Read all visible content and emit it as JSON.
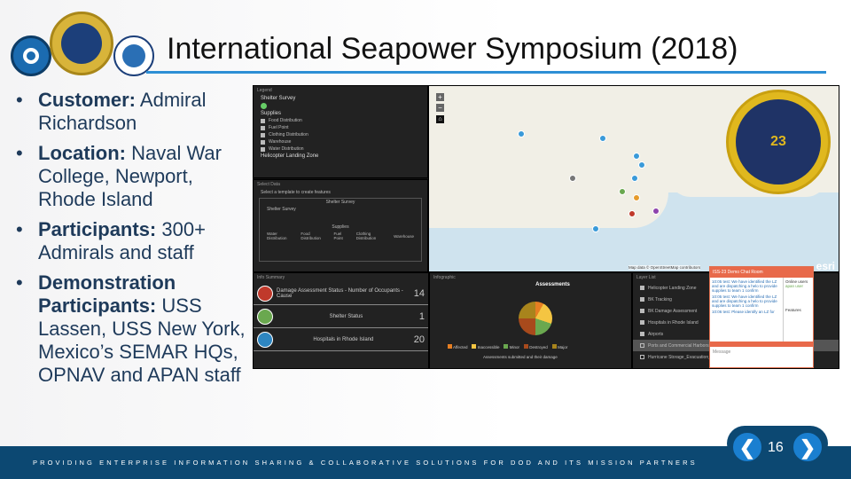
{
  "slide": {
    "title": "International Seapower Symposium (2018)",
    "page_number": "16",
    "footer": "PROVIDING ENTERPRISE INFORMATION SHARING & COLLABORATIVE SOLUTIONS FOR DOD AND ITS MISSION PARTNERS",
    "prev_icon": "chevron-left-icon",
    "next_icon": "chevron-right-icon",
    "prev_glyph": "❮",
    "next_glyph": "❯"
  },
  "logos": [
    "APAN logo",
    "Office of the Secretary United States Air Force seal",
    "PWC seal",
    "International Seapower Symposium 23 seal"
  ],
  "bullets": [
    {
      "label": "Customer:",
      "text": " Admiral Richardson"
    },
    {
      "label": "Location:",
      "text": " Naval War College, Newport, Rhode Island"
    },
    {
      "label": "Participants:",
      "text": " 300+ Admirals and staff"
    },
    {
      "label": "Demonstration Participants:",
      "text": "  USS Lassen, USS New York, Mexico’s SEMAR HQs, OPNAV and APAN staff"
    }
  ],
  "app": {
    "legend": {
      "title": "Legend",
      "layer1": "Shelter Survey",
      "group": "Supplies",
      "items": [
        "Food Distribution",
        "Fuel Point",
        "Clothing Distribution",
        "Warehouse",
        "Water Distribution"
      ],
      "layer3": "Helicopter Landing Zone"
    },
    "select": {
      "title": "Select Data",
      "hint": "Select a template to create features",
      "group1": "Shelter Survey",
      "item1": "Shelter Survey",
      "group2": "Supplies",
      "items": [
        "Water Distribution",
        "Food Distribution",
        "Fuel Point",
        "Clothing Distribution",
        "Warehouse"
      ]
    },
    "map": {
      "attribution": "Map data © OpenStreetMap contributors",
      "brand": "esri",
      "seal_number": "23"
    },
    "info_summary": {
      "title": "Info Summary",
      "rows": [
        {
          "label": "Damage Assessment Status - Number of Occupants - Cause",
          "value": "14",
          "color": "#c0392b"
        },
        {
          "label": "Shelter Status",
          "value": "1",
          "color": "#6aa84f"
        },
        {
          "label": "Hospitals in Rhode Island",
          "value": "20",
          "color": "#2e86c1"
        }
      ]
    },
    "infographic": {
      "title": "Infographic",
      "chart_title": "Assessments",
      "labels": [
        "Affected",
        "Inaccessible",
        "Minor",
        "Destroyed",
        "Major"
      ],
      "caption": "Assessments submitted and their damage"
    },
    "layer_list": {
      "title": "Layer List",
      "layers": [
        "Helicopter Landing Zone",
        "BK Tracking",
        "BK Damage Assessment",
        "Hospitals in Rhode Island",
        "Airports",
        "Ports and Commercial Harbors",
        "Hurricane Storage_Evacuation_Areas (Rhode Island)"
      ]
    },
    "chat": {
      "title": "ISS-23 Demo Chat Room",
      "messages": [
        "10:05 test: We have identified the LZ and are dispatching a helo to provide supplies to team 1 confirm",
        "10:05 test: We have identified the LZ and are dispatching a helo to provide supplies to team 1 confirm",
        "10:06 test: Please identify an LZ for"
      ],
      "placeholder": "Message",
      "online_label": "Online users",
      "online_user": "apan user",
      "features_label": "Features"
    }
  }
}
